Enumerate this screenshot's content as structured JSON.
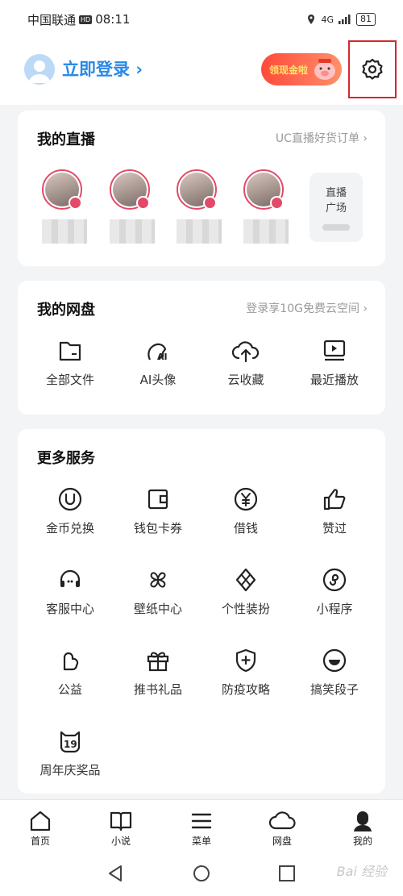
{
  "status": {
    "carrier": "中国联通",
    "hd": "HD",
    "time": "08:11",
    "network": "4G",
    "battery": "81"
  },
  "header": {
    "login_label": "立即登录",
    "chevron": "›",
    "promo_text": "领现金啦",
    "settings_icon": "gear-icon"
  },
  "live": {
    "title": "我的直播",
    "link": "UC直播好货订单 ›",
    "streamers": [
      {
        "id": 1
      },
      {
        "id": 2
      },
      {
        "id": 3
      },
      {
        "id": 4
      }
    ],
    "plaza_line1": "直播",
    "plaza_line2": "广场"
  },
  "disk": {
    "title": "我的网盘",
    "link": "登录享10G免费云空间 ›",
    "items": [
      {
        "label": "全部文件",
        "icon": "folder-icon"
      },
      {
        "label": "AI头像",
        "icon": "ai-avatar-icon"
      },
      {
        "label": "云收藏",
        "icon": "cloud-upload-icon"
      },
      {
        "label": "最近播放",
        "icon": "recent-play-icon"
      }
    ]
  },
  "services": {
    "title": "更多服务",
    "items": [
      {
        "label": "金币兑换",
        "icon": "coin-icon"
      },
      {
        "label": "钱包卡券",
        "icon": "wallet-icon"
      },
      {
        "label": "借钱",
        "icon": "yuan-icon"
      },
      {
        "label": "赞过",
        "icon": "thumbs-up-icon"
      },
      {
        "label": "客服中心",
        "icon": "headset-icon"
      },
      {
        "label": "壁纸中心",
        "icon": "pinwheel-icon"
      },
      {
        "label": "个性装扮",
        "icon": "style-icon"
      },
      {
        "label": "小程序",
        "icon": "mini-program-icon"
      },
      {
        "label": "公益",
        "icon": "charity-icon"
      },
      {
        "label": "推书礼品",
        "icon": "gift-icon"
      },
      {
        "label": "防疫攻略",
        "icon": "shield-plus-icon"
      },
      {
        "label": "搞笑段子",
        "icon": "smile-icon"
      },
      {
        "label": "周年庆奖品",
        "icon": "anniversary-icon"
      }
    ]
  },
  "tabs": [
    {
      "label": "首页",
      "icon": "home-icon"
    },
    {
      "label": "小说",
      "icon": "book-icon"
    },
    {
      "label": "菜单",
      "icon": "menu-icon"
    },
    {
      "label": "网盘",
      "icon": "cloud-icon"
    },
    {
      "label": "我的",
      "icon": "profile-icon"
    }
  ],
  "watermark": "Bai 经验"
}
